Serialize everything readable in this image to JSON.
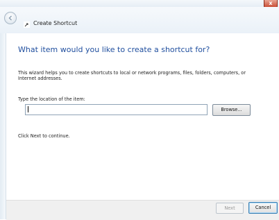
{
  "window": {
    "title": "Create Shortcut",
    "close_glyph": "x"
  },
  "icons": {
    "back": "back-arrow-icon",
    "shortcut": "shortcut-arrow-icon",
    "close": "close-icon"
  },
  "main": {
    "heading": "What item would you like to create a shortcut for?",
    "description": "This wizard helps you to create shortcuts to local or network programs, files, folders, computers, or Internet addresses.",
    "location_label": "Type the location of the item:",
    "location_value": "",
    "browse_label": "Browse...",
    "continue_text": "Click Next to continue."
  },
  "footer": {
    "next_label": "Next",
    "cancel_label": "Cancel"
  },
  "colors": {
    "heading": "#1f4e9e",
    "close_button": "#c7462e"
  }
}
